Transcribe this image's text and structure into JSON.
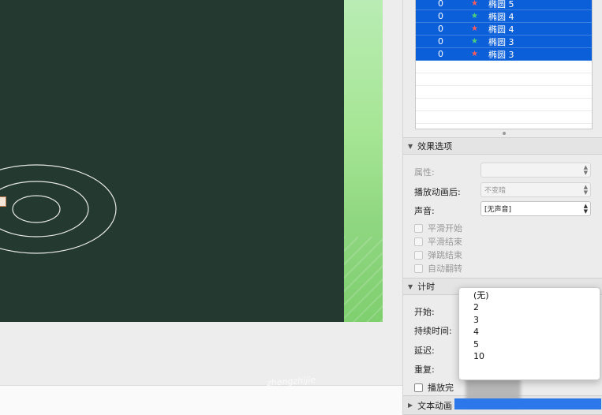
{
  "animation_list": {
    "rows": [
      {
        "order": "0",
        "icon": "animation-entry-icon",
        "color": "#ff5a5a",
        "name": "椭圆 5"
      },
      {
        "order": "0",
        "icon": "animation-move-icon",
        "color": "#4fd07a",
        "name": "椭圆 4"
      },
      {
        "order": "0",
        "icon": "animation-entry-icon",
        "color": "#ff5a5a",
        "name": "椭圆 4"
      },
      {
        "order": "0",
        "icon": "animation-move-icon",
        "color": "#4fd07a",
        "name": "椭圆 3"
      },
      {
        "order": "0",
        "icon": "animation-entry-icon",
        "color": "#ff5a5a",
        "name": "椭圆 3"
      }
    ]
  },
  "effect_options": {
    "header": "效果选项",
    "attribute_label": "属性:",
    "after_play_label": "播放动画后:",
    "after_play_value": "不变暗",
    "sound_label": "声音:",
    "sound_value": "[无声音]",
    "checkboxes": [
      "平滑开始",
      "平滑结束",
      "弹跳结束",
      "自动翻转"
    ]
  },
  "timing": {
    "header": "计时",
    "start_label": "开始:",
    "duration_label": "持续时间:",
    "delay_label": "延迟:",
    "repeat_label": "重复:",
    "play_checkbox_label": "播放完"
  },
  "text_animation": {
    "header": "文本动画"
  },
  "repeat_dropdown": {
    "options": [
      "(无)",
      "2",
      "3",
      "4",
      "5",
      "10"
    ]
  },
  "watermark": "zhengzhijie",
  "colors": {
    "selection_blue": "#0b5fd9",
    "slide_bg": "#243a30",
    "slide_accent_green": "#a6e695"
  }
}
